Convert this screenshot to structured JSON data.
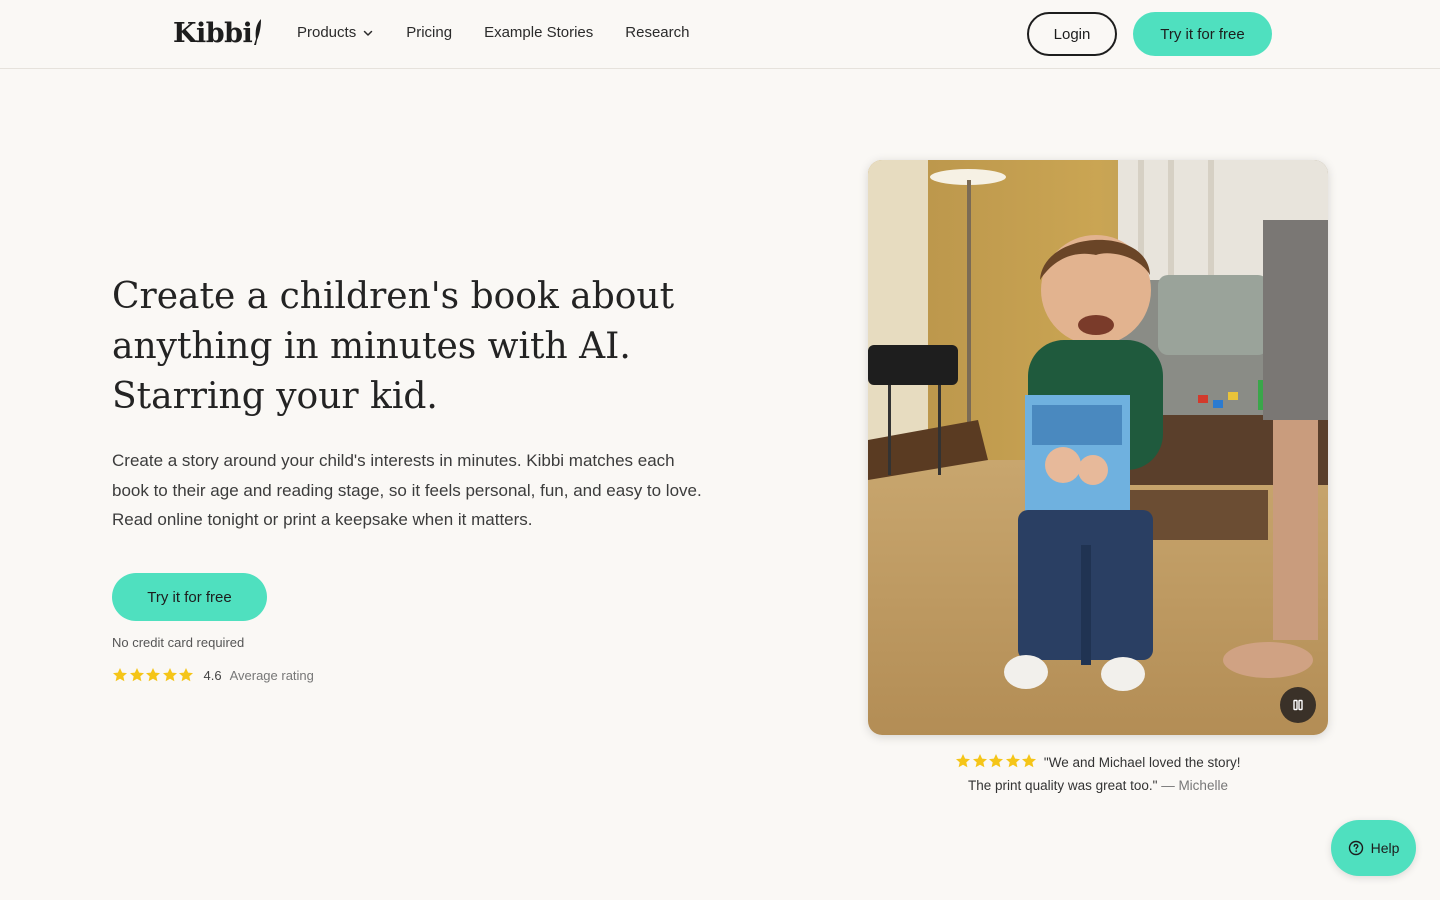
{
  "header": {
    "logo": "Kibbi",
    "nav": [
      {
        "label": "Products",
        "has_dropdown": true
      },
      {
        "label": "Pricing"
      },
      {
        "label": "Example Stories"
      },
      {
        "label": "Research"
      }
    ],
    "login_label": "Login",
    "try_label": "Try it for free"
  },
  "hero": {
    "title_line1": "Create a children's book about",
    "title_line2": "anything in minutes with AI.",
    "title_line3": "Starring your kid.",
    "description": "Create a story around your child's interests in minutes. Kibbi matches each book to their age and reading stage, so it feels personal, fun, and easy to love. Read online tonight or print a keepsake when it matters.",
    "cta_label": "Try it for free",
    "no_credit_card": "No credit card required",
    "rating_value": "4.6",
    "rating_label": "Average rating",
    "rating_stars": 5
  },
  "video": {
    "state": "playing",
    "control_icon": "pause-icon"
  },
  "testimonial": {
    "stars": 5,
    "quote_line1": "\"We and Michael loved the story!",
    "quote_line2": "The print quality was great too.\"",
    "author": "— Michelle"
  },
  "help": {
    "label": "Help"
  },
  "colors": {
    "accent": "#4fe0bf",
    "background": "#faf8f5",
    "star": "#f5c518"
  }
}
